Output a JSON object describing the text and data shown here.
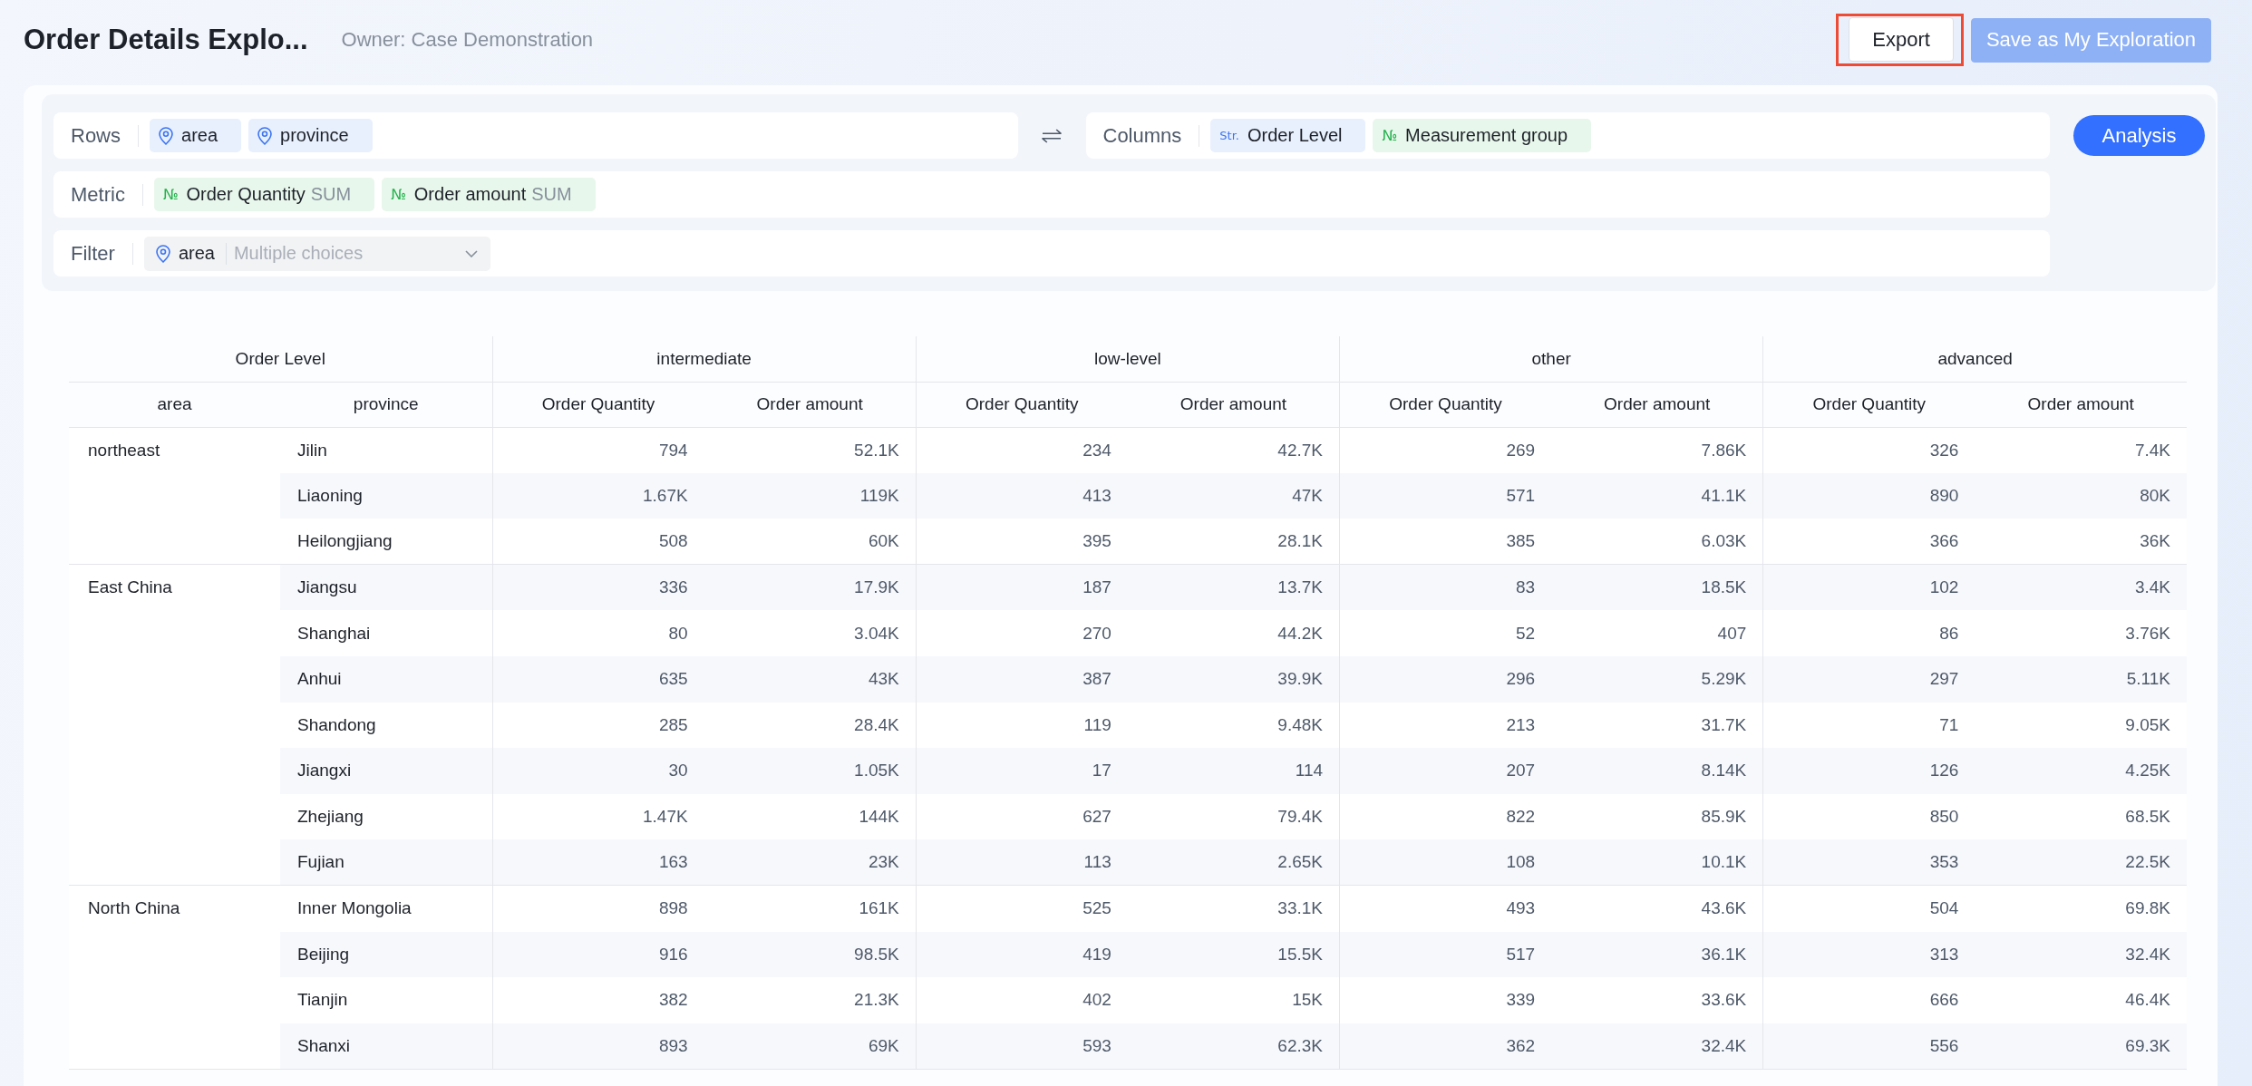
{
  "header": {
    "title": "Order Details Explo...",
    "owner": "Owner: Case Demonstration",
    "actions": [
      {
        "kind": "secondary",
        "label": "Export",
        "highlighted": true,
        "disabled": false
      },
      {
        "kind": "primary",
        "label": "Save as My Exploration",
        "highlighted": false,
        "disabled": true
      }
    ]
  },
  "config": {
    "rows": {
      "label": "Rows",
      "fields": [
        {
          "kind": "location",
          "label": "area"
        },
        {
          "kind": "location",
          "label": "province"
        }
      ]
    },
    "columns": {
      "label": "Columns",
      "fields": [
        {
          "kind": "string",
          "tag": "Str.",
          "label": "Order Level"
        },
        {
          "kind": "measure",
          "tag": "№",
          "label": "Measurement group"
        }
      ]
    },
    "metric": {
      "label": "Metric",
      "fields": [
        {
          "kind": "measure",
          "tag": "№",
          "label": "Order Quantity",
          "aggregation": "SUM"
        },
        {
          "kind": "measure",
          "tag": "№",
          "label": "Order amount",
          "aggregation": "SUM"
        }
      ]
    },
    "filter": {
      "label": "Filter",
      "conditions": [
        {
          "kind": "location",
          "label": "area",
          "placeholder": "Multiple choices"
        }
      ]
    },
    "analysis_button": "Analysis"
  },
  "table": {
    "corner_header": "Order Level",
    "row_headers": [
      "area",
      "province"
    ],
    "column_groups": [
      {
        "label": "intermediate",
        "measures": [
          "Order Quantity",
          "Order amount"
        ]
      },
      {
        "label": "low-level",
        "measures": [
          "Order Quantity",
          "Order amount"
        ]
      },
      {
        "label": "other",
        "measures": [
          "Order Quantity",
          "Order amount"
        ]
      },
      {
        "label": "advanced",
        "measures": [
          "Order Quantity",
          "Order amount"
        ]
      }
    ],
    "row_groups": [
      {
        "area": "northeast",
        "rows": [
          {
            "province": "Jilin",
            "values": [
              "794",
              "52.1K",
              "234",
              "42.7K",
              "269",
              "7.86K",
              "326",
              "7.4K"
            ]
          },
          {
            "province": "Liaoning",
            "values": [
              "1.67K",
              "119K",
              "413",
              "47K",
              "571",
              "41.1K",
              "890",
              "80K"
            ]
          },
          {
            "province": "Heilongjiang",
            "values": [
              "508",
              "60K",
              "395",
              "28.1K",
              "385",
              "6.03K",
              "366",
              "36K"
            ]
          }
        ]
      },
      {
        "area": "East China",
        "rows": [
          {
            "province": "Jiangsu",
            "values": [
              "336",
              "17.9K",
              "187",
              "13.7K",
              "83",
              "18.5K",
              "102",
              "3.4K"
            ]
          },
          {
            "province": "Shanghai",
            "values": [
              "80",
              "3.04K",
              "270",
              "44.2K",
              "52",
              "407",
              "86",
              "3.76K"
            ]
          },
          {
            "province": "Anhui",
            "values": [
              "635",
              "43K",
              "387",
              "39.9K",
              "296",
              "5.29K",
              "297",
              "5.11K"
            ]
          },
          {
            "province": "Shandong",
            "values": [
              "285",
              "28.4K",
              "119",
              "9.48K",
              "213",
              "31.7K",
              "71",
              "9.05K"
            ]
          },
          {
            "province": "Jiangxi",
            "values": [
              "30",
              "1.05K",
              "17",
              "114",
              "207",
              "8.14K",
              "126",
              "4.25K"
            ]
          },
          {
            "province": "Zhejiang",
            "values": [
              "1.47K",
              "144K",
              "627",
              "79.4K",
              "822",
              "85.9K",
              "850",
              "68.5K"
            ]
          },
          {
            "province": "Fujian",
            "values": [
              "163",
              "23K",
              "113",
              "2.65K",
              "108",
              "10.1K",
              "353",
              "22.5K"
            ]
          }
        ]
      },
      {
        "area": "North China",
        "rows": [
          {
            "province": "Inner Mongolia",
            "values": [
              "898",
              "161K",
              "525",
              "33.1K",
              "493",
              "43.6K",
              "504",
              "69.8K"
            ]
          },
          {
            "province": "Beijing",
            "values": [
              "916",
              "98.5K",
              "419",
              "15.5K",
              "517",
              "36.1K",
              "313",
              "32.4K"
            ]
          },
          {
            "province": "Tianjin",
            "values": [
              "382",
              "21.3K",
              "402",
              "15K",
              "339",
              "33.6K",
              "666",
              "46.4K"
            ]
          },
          {
            "province": "Shanxi",
            "values": [
              "893",
              "69K",
              "593",
              "62.3K",
              "362",
              "32.4K",
              "556",
              "69.3K"
            ]
          }
        ]
      }
    ]
  }
}
